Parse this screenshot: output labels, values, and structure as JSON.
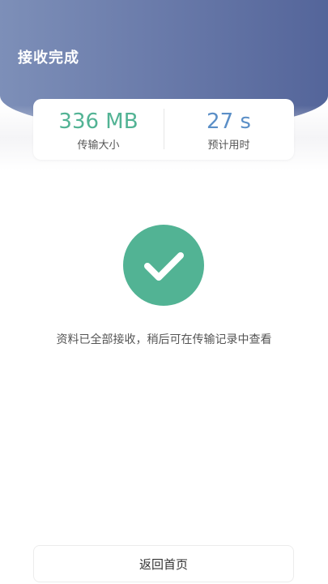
{
  "header": {
    "title": "接收完成"
  },
  "stats": {
    "size_value": "336 MB",
    "size_label": "传输大小",
    "time_value": "27 s",
    "time_label": "预计用时"
  },
  "result": {
    "icon": "checkmark-icon",
    "message": "资料已全部接收，稍后可在传输记录中查看"
  },
  "footer": {
    "home_button_label": "返回首页"
  },
  "colors": {
    "accent_green": "#52b394",
    "accent_blue": "#5b8fc7",
    "header_gradient_start": "#7d8fb8",
    "header_gradient_end": "#54659a"
  }
}
